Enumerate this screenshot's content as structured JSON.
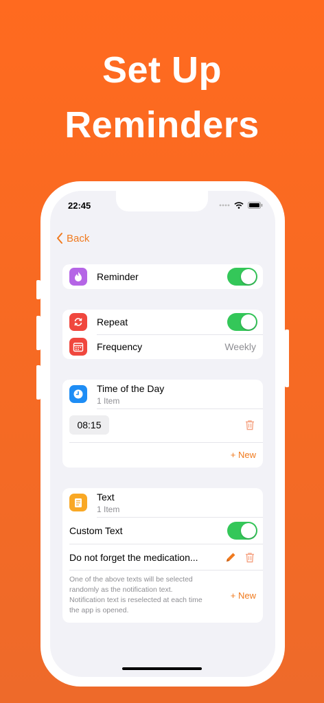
{
  "headline": {
    "line1": "Set Up",
    "line2": "Reminders"
  },
  "status_bar": {
    "time": "22:45"
  },
  "nav": {
    "back_label": "Back"
  },
  "reminder_section": {
    "label": "Reminder",
    "toggle_on": true
  },
  "repeat_section": {
    "repeat_label": "Repeat",
    "repeat_on": true,
    "frequency_label": "Frequency",
    "frequency_value": "Weekly"
  },
  "time_section": {
    "title": "Time of the Day",
    "count": "1 Item",
    "times": [
      "08:15"
    ],
    "new_label": "+ New"
  },
  "text_section": {
    "title": "Text",
    "count": "1 Item",
    "custom_text_label": "Custom Text",
    "custom_text_on": true,
    "items": [
      "Do not forget the medication..."
    ],
    "note": "One of the above texts will be selected randomly as the notification text. Notification text is reselected at each time the app is opened.",
    "new_label": "+ New"
  },
  "colors": {
    "accent": "#F07A1E",
    "toggle_on": "#34C759",
    "reminder_icon": "#B565E6",
    "repeat_icon": "#F0473E",
    "time_icon": "#1E8DF5",
    "text_icon": "#F9A825"
  }
}
